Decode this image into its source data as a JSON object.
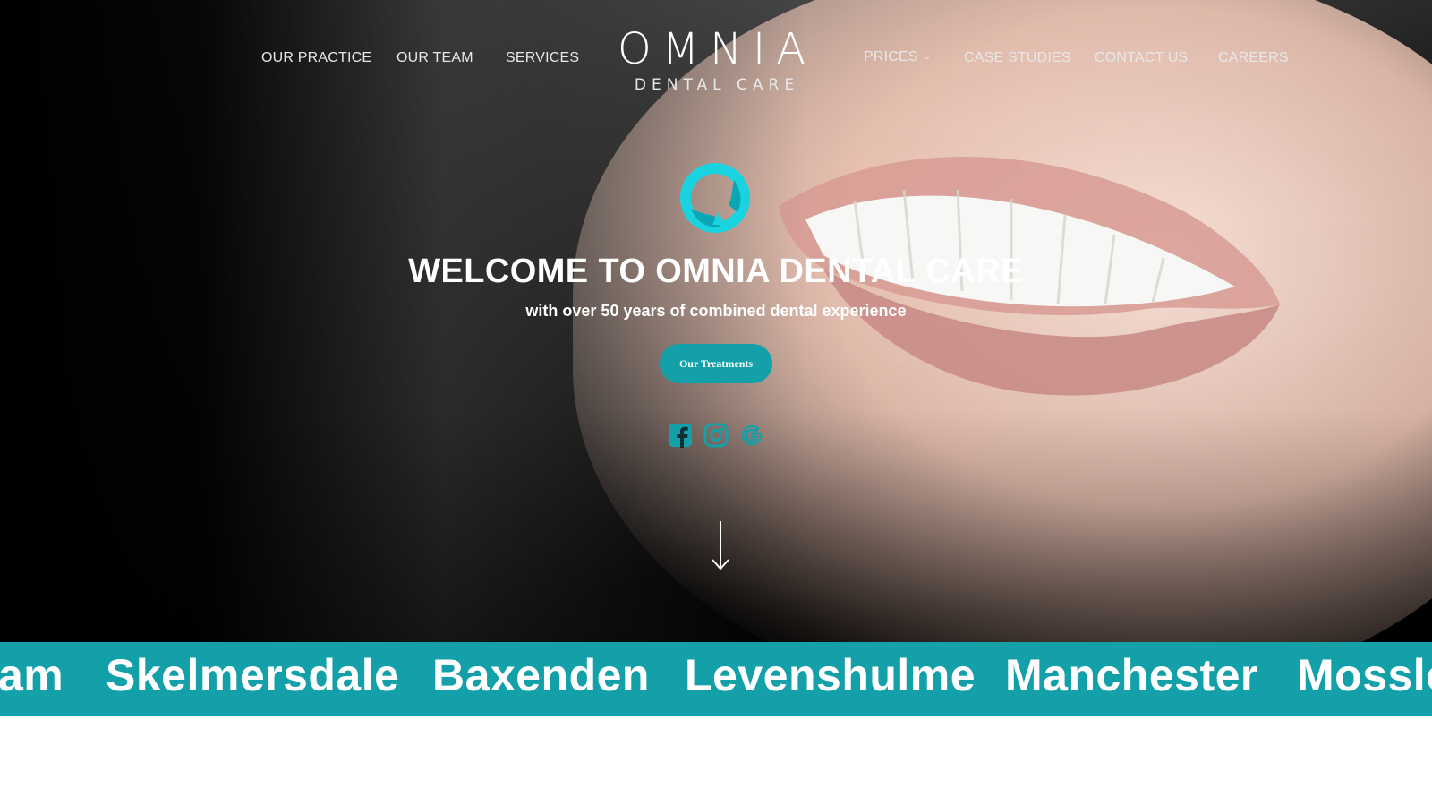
{
  "nav": {
    "left": [
      "OUR PRACTICE",
      "OUR TEAM",
      "SERVICES"
    ],
    "prices": "PRICES",
    "right": [
      "CASE STUDIES",
      "CONTACT US",
      "CAREERS"
    ]
  },
  "logo": {
    "main": "OMNIA",
    "sub": "DENTAL CARE"
  },
  "hero": {
    "title": "WELCOME TO OMNIA DENTAL CARE",
    "subtitle": "with over 50 years of combined dental experience",
    "cta": "Our Treatments"
  },
  "social": [
    "facebook-icon",
    "instagram-icon",
    "google-icon"
  ],
  "locations": [
    "am",
    "Skelmersdale",
    "Baxenden",
    "Levenshulme",
    "Manchester",
    "Mossle"
  ],
  "colors": {
    "accent": "#14a0a8",
    "emblem": "#19d3e0"
  }
}
